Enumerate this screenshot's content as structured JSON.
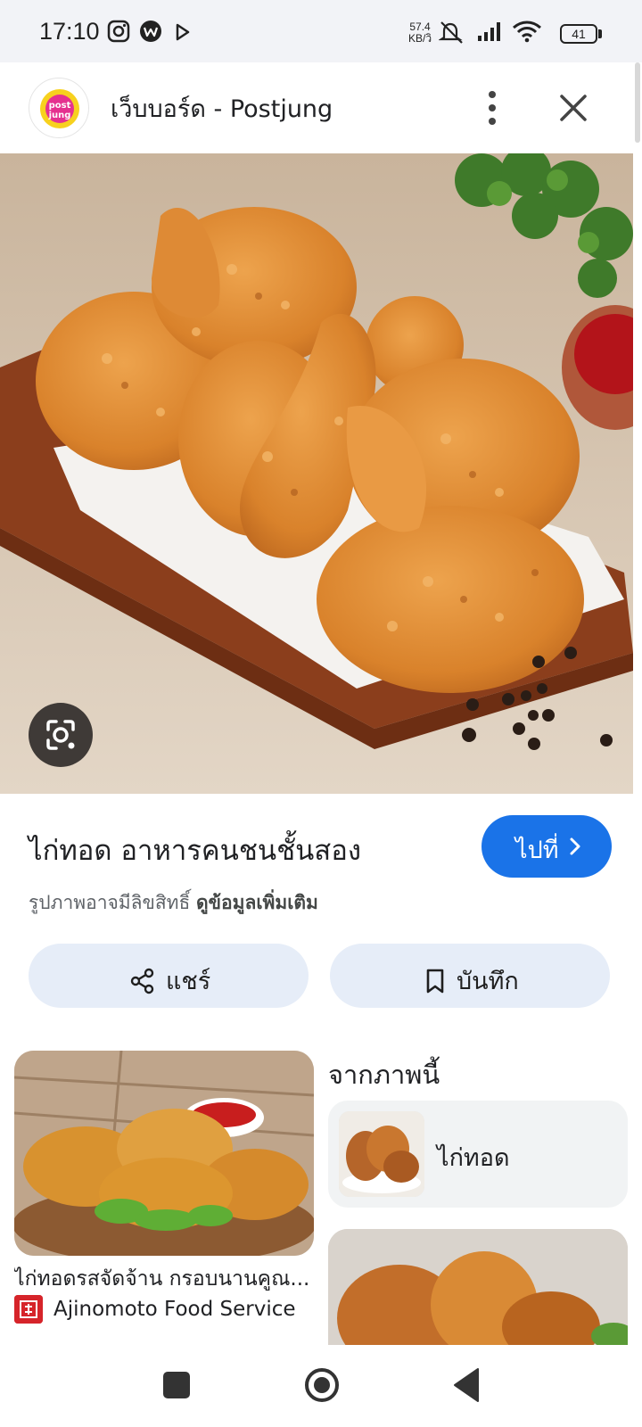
{
  "status_bar": {
    "time": "17:10",
    "net_speed_value": "57.4",
    "net_speed_unit": "KB/วิ",
    "battery": "41",
    "icons": [
      "instagram-icon",
      "w-app-icon",
      "play-icon",
      "mute-icon",
      "signal-icon",
      "wifi-icon",
      "battery-icon"
    ]
  },
  "header": {
    "logo_text": "Postjung",
    "title": "เว็บบอร์ด - Postjung",
    "menu_icon": "more-vert-icon",
    "close_icon": "close-icon"
  },
  "main_image": {
    "lens_icon": "lens-icon"
  },
  "details": {
    "title": "ไก่ทอด อาหารคนชนชั้นสอง",
    "visit_label": "ไปที่",
    "copyright_note": "รูปภาพอาจมีลิขสิทธิ์",
    "learn_more": "ดูข้อมูลเพิ่มเติม",
    "share_label": "แชร์",
    "save_label": "บันทึก"
  },
  "related": {
    "caption": "ไก่ทอดรสจัดจ้าน กรอบนานคูณ...",
    "source": "Ajinomoto Food Service"
  },
  "from_image": {
    "heading": "จากภาพนี้",
    "chip_label": "ไก่ทอด"
  },
  "nav": {
    "icons": [
      "recents-icon",
      "home-icon",
      "back-icon"
    ]
  },
  "colors": {
    "accent": "#1a73e8",
    "action_bg": "#e6edf8",
    "chip_bg": "#f1f3f4"
  }
}
